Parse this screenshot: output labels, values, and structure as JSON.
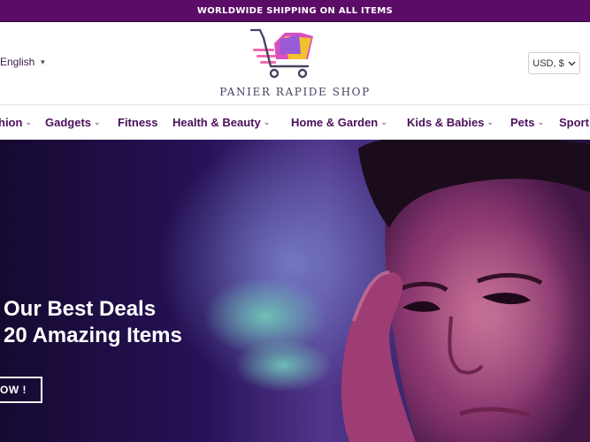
{
  "announcement": "WORLDWIDE SHIPPING ON ALL ITEMS",
  "header": {
    "language": "English",
    "currency": "USD, $",
    "brand": "PANIER RAPIDE SHOP"
  },
  "nav": {
    "items": [
      {
        "label": "hion",
        "dropdown": true
      },
      {
        "label": "Gadgets",
        "dropdown": true
      },
      {
        "label": "Fitness",
        "dropdown": false
      },
      {
        "label": "Health & Beauty",
        "dropdown": true
      },
      {
        "label": "Home & Garden",
        "dropdown": true
      },
      {
        "label": "Kids & Babies",
        "dropdown": true
      },
      {
        "label": "Pets",
        "dropdown": true
      },
      {
        "label": "Sport",
        "dropdown": false
      }
    ]
  },
  "hero": {
    "line1": "Our Best Deals",
    "line2": "20 Amazing Items",
    "button": "OW !"
  },
  "colors": {
    "announcement_bg": "#5b0c66",
    "nav_text": "#4b0f5a",
    "hero_bg": "#1a0c3b"
  },
  "icons": {
    "logo": "shopping-cart-icon",
    "language_caret": "caret-down-icon",
    "currency_chevron": "chevron-down-icon",
    "nav_chevron": "chevron-down-icon"
  }
}
